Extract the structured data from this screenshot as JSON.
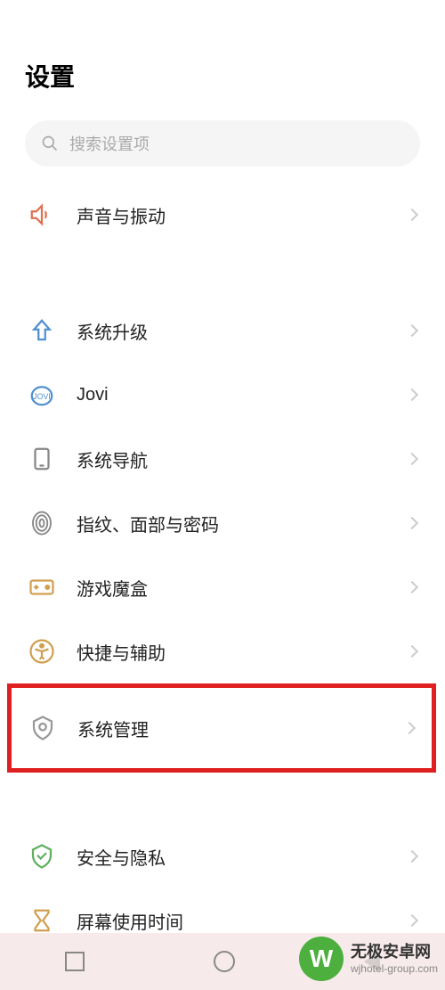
{
  "header": {
    "title": "设置"
  },
  "search": {
    "placeholder": "搜索设置项"
  },
  "items": {
    "sound": {
      "label": "声音与振动"
    },
    "upgrade": {
      "label": "系统升级"
    },
    "jovi": {
      "label": "Jovi"
    },
    "navigation": {
      "label": "系统导航"
    },
    "biometric": {
      "label": "指纹、面部与密码"
    },
    "gamebox": {
      "label": "游戏魔盒"
    },
    "shortcut": {
      "label": "快捷与辅助"
    },
    "sysmanage": {
      "label": "系统管理"
    },
    "security": {
      "label": "安全与隐私"
    },
    "screentime": {
      "label": "屏幕使用时间"
    }
  },
  "watermark": {
    "logo": "W",
    "main": "无极安卓网",
    "sub": "wjhotel-group.com"
  }
}
